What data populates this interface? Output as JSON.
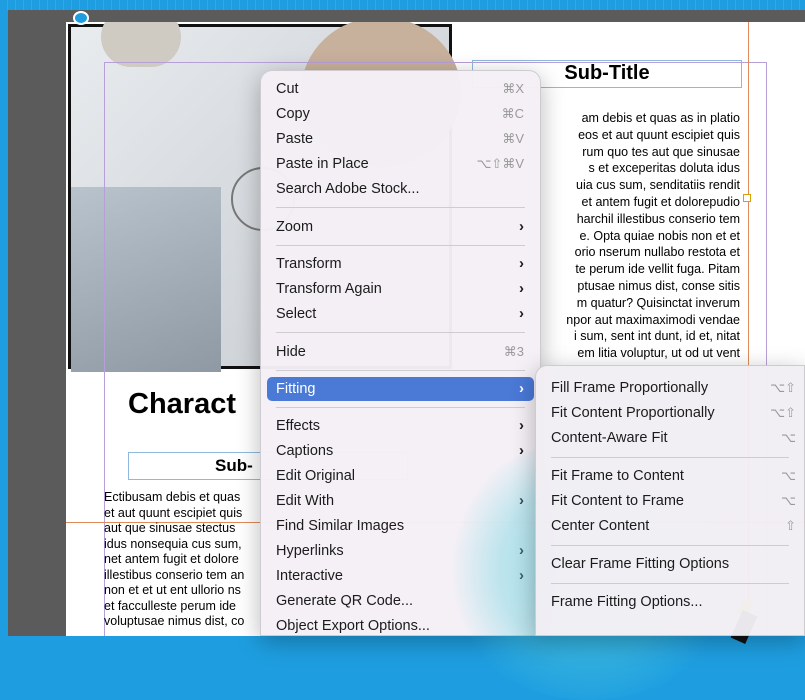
{
  "document": {
    "subtitle": "Sub-Title",
    "heading": "Charact",
    "sub_heading": "Sub-",
    "right_column_lines": [
      "am debis et quas as in platio",
      "eos et aut quunt escipiet quis",
      "rum quo tes aut que sinusae",
      "s et exceperitas doluta idus",
      "uia cus sum, senditatiis rendit",
      "et antem fugit et dolorepudio",
      "harchil illestibus conserio tem",
      "e. Opta quiae nobis non et et",
      "orio nserum nullabo restota et",
      "te perum ide vellit fuga. Pitam",
      "ptusae nimus dist, conse sitis",
      "m quatur? Quisinctat inverum",
      "npor aut maximaximodi vendae",
      "i sum, sent int dunt, id et, nitat",
      "em litia voluptur, ut od ut vent"
    ],
    "left_column_lines": [
      "Ectibusam debis et quas",
      "et aut quunt escipiet quis",
      "aut que sinusae stectus",
      "idus nonsequia cus sum,",
      "net antem fugit et dolore",
      "illestibus conserio tem an",
      "non et et ut ent ullorio ns",
      "et facculleste perum ide",
      "voluptusae nimus dist, co"
    ]
  },
  "context_menu": {
    "items": [
      {
        "label": "Cut",
        "shortcut": "⌘X"
      },
      {
        "label": "Copy",
        "shortcut": "⌘C"
      },
      {
        "label": "Paste",
        "shortcut": "⌘V"
      },
      {
        "label": "Paste in Place",
        "shortcut": "⌥⇧⌘V"
      },
      {
        "label": "Search Adobe Stock...",
        "shortcut": ""
      },
      {
        "label": "Zoom",
        "shortcut": ""
      },
      {
        "label": "Transform",
        "shortcut": ""
      },
      {
        "label": "Transform Again",
        "shortcut": ""
      },
      {
        "label": "Select",
        "shortcut": ""
      },
      {
        "label": "Hide",
        "shortcut": "⌘3"
      },
      {
        "label": "Fitting",
        "shortcut": ""
      },
      {
        "label": "Effects",
        "shortcut": ""
      },
      {
        "label": "Captions",
        "shortcut": ""
      },
      {
        "label": "Edit Original",
        "shortcut": ""
      },
      {
        "label": "Edit With",
        "shortcut": ""
      },
      {
        "label": "Find Similar Images",
        "shortcut": ""
      },
      {
        "label": "Hyperlinks",
        "shortcut": ""
      },
      {
        "label": "Interactive",
        "shortcut": ""
      },
      {
        "label": "Generate QR Code...",
        "shortcut": ""
      },
      {
        "label": "Object Export Options...",
        "shortcut": ""
      }
    ]
  },
  "fitting_submenu": {
    "items": [
      {
        "label": "Fill Frame Proportionally",
        "shortcut": "⌥⇧"
      },
      {
        "label": "Fit Content Proportionally",
        "shortcut": "⌥⇧"
      },
      {
        "label": "Content-Aware Fit",
        "shortcut": "⌥"
      },
      {
        "label": "Fit Frame to Content",
        "shortcut": "⌥"
      },
      {
        "label": "Fit Content to Frame",
        "shortcut": "⌥"
      },
      {
        "label": "Center Content",
        "shortcut": "⇧"
      },
      {
        "label": "Clear Frame Fitting Options",
        "shortcut": ""
      },
      {
        "label": "Frame Fitting Options...",
        "shortcut": ""
      }
    ]
  },
  "icons": {
    "submenu_arrow": "›"
  },
  "colors": {
    "highlight": "#4a79d6",
    "app_chrome": "#1e9ee0"
  }
}
